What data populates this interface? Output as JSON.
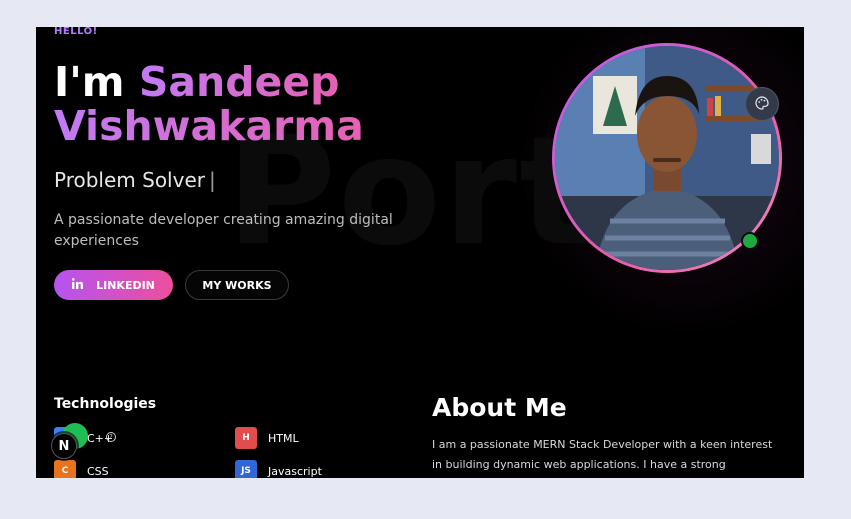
{
  "hero": {
    "greeting": "HELLO!",
    "intro": "I'm",
    "name_first": "Sandeep",
    "name_last": "Vishwakarma",
    "role": "Problem Solver",
    "cursor": "|",
    "description": "A passionate developer creating amazing digital experiences",
    "watermark": "Port",
    "buttons": {
      "linkedin_label": "LINKEDIN",
      "linkedin_icon": "linkedin-icon",
      "works_label": "MY WORKS"
    }
  },
  "avatar": {
    "status": "online",
    "theme_button_icon": "palette-icon"
  },
  "technologies": {
    "title": "Technologies",
    "items": [
      {
        "label": "C++",
        "badge": "C",
        "color": "#3b82f6"
      },
      {
        "label": "HTML",
        "badge": "H",
        "color": "#e34c4c"
      },
      {
        "label": "CSS",
        "badge": "C",
        "color": "#e8731e"
      },
      {
        "label": "Javascript",
        "badge": "JS",
        "color": "#2f66d8"
      }
    ]
  },
  "about": {
    "title": "About Me",
    "text": "I am a passionate MERN Stack Developer with a keen interest in building dynamic web applications. I have a strong foundation in"
  },
  "devtools": {
    "badge": "N",
    "help": "?"
  },
  "colors": {
    "accent_purple": "#b554f0",
    "accent_pink": "#ec4f9c",
    "background": "#000000",
    "page_bg": "#e6e9f4"
  }
}
